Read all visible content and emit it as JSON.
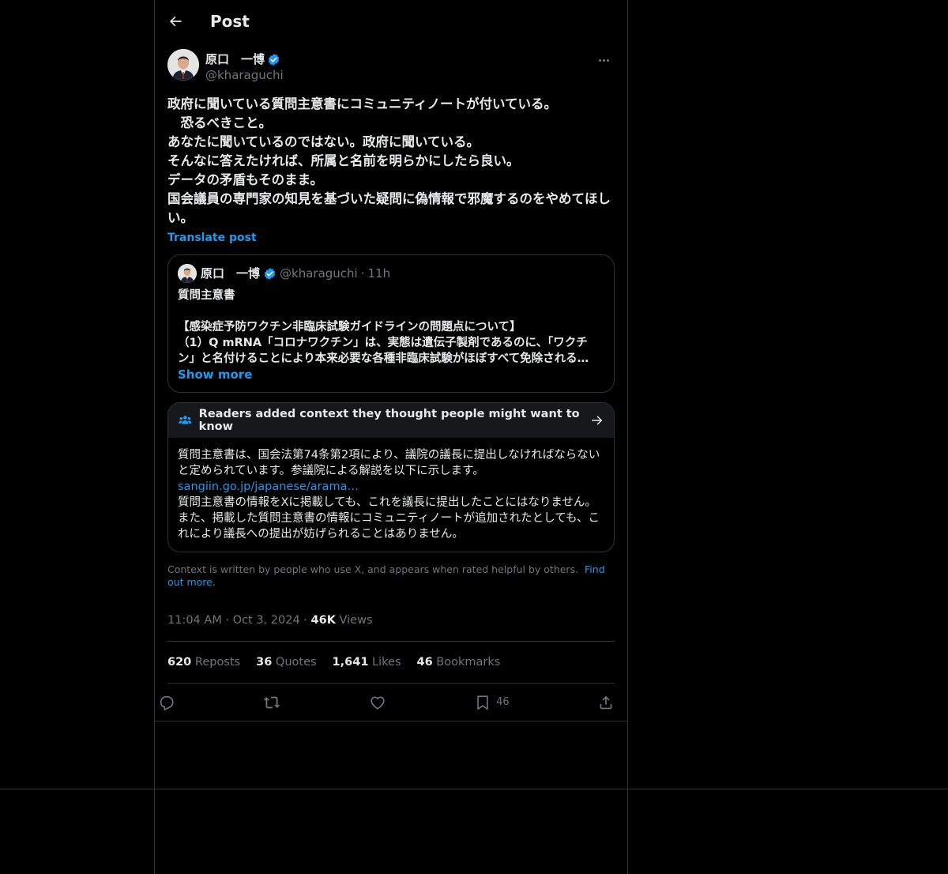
{
  "header": {
    "title": "Post"
  },
  "post": {
    "author_name": "原口　一博",
    "handle": "@kharaguchi",
    "text": "政府に聞いている質問主意書にコミュニティノートが付いている。\n　恐るべきこと。\nあなたに聞いているのではない。政府に聞いている。\nそんなに答えたければ、所属と名前を明らかにしたら良い。\nデータの矛盾もそのまま。\n国会議員の専門家の知見を基づいた疑問に偽情報で邪魔するのをやめてほしい。",
    "translate_label": "Translate post"
  },
  "quote": {
    "author_name": "原口　一博",
    "handle": "@kharaguchi",
    "dot": "·",
    "time": "11h",
    "text": "質問主意書\n\n【感染症予防ワクチン非臨床試験ガイドラインの問題点について】\n（1）Q mRNA「コロナワクチン」は、実態は遺伝子製剤であるのに、「ワクチン」と名付けることにより本来必要な各種非臨床試験がほぼすべて免除される…",
    "show_more": "Show more"
  },
  "notes": {
    "title": "Readers added context they thought people might want to know",
    "para1": "質問主意書は、国会法第74条第2項により、議院の議長に提出しなければならないと定められています。参議院による解説を以下に示します。",
    "link": "sangiin.go.jp/japanese/arama…",
    "para2": "質問主意書の情報をXに掲載しても、これを議長に提出したことにはなりません。また、掲載した質問主意書の情報にコミュニティノートが追加されたとしても、これにより議長への提出が妨げられることはありません。"
  },
  "context": {
    "text": "Context is written by people who use X, and appears when rated helpful by others.",
    "link": "Find out more."
  },
  "meta": {
    "time": "11:04 AM",
    "dot1": "·",
    "date": "Oct 3, 2024",
    "dot2": "·",
    "views_count": "46K",
    "views_label": "Views"
  },
  "stats": {
    "reposts_count": "620",
    "reposts_label": "Reposts",
    "quotes_count": "36",
    "quotes_label": "Quotes",
    "likes_count": "1,641",
    "likes_label": "Likes",
    "bookmarks_count": "46",
    "bookmarks_label": "Bookmarks"
  },
  "actions": {
    "bookmark_count": "46"
  },
  "icons": {
    "back": "back-arrow-icon",
    "verified": "verified-badge-icon",
    "more": "more-icon",
    "community": "community-notes-icon",
    "reply": "reply-icon",
    "repost": "repost-icon",
    "like": "heart-icon",
    "bookmark": "bookmark-icon",
    "share": "share-icon"
  },
  "colors": {
    "accent": "#1d9bf0",
    "background": "#000000",
    "border": "#2f3336",
    "muted": "#71767b"
  }
}
